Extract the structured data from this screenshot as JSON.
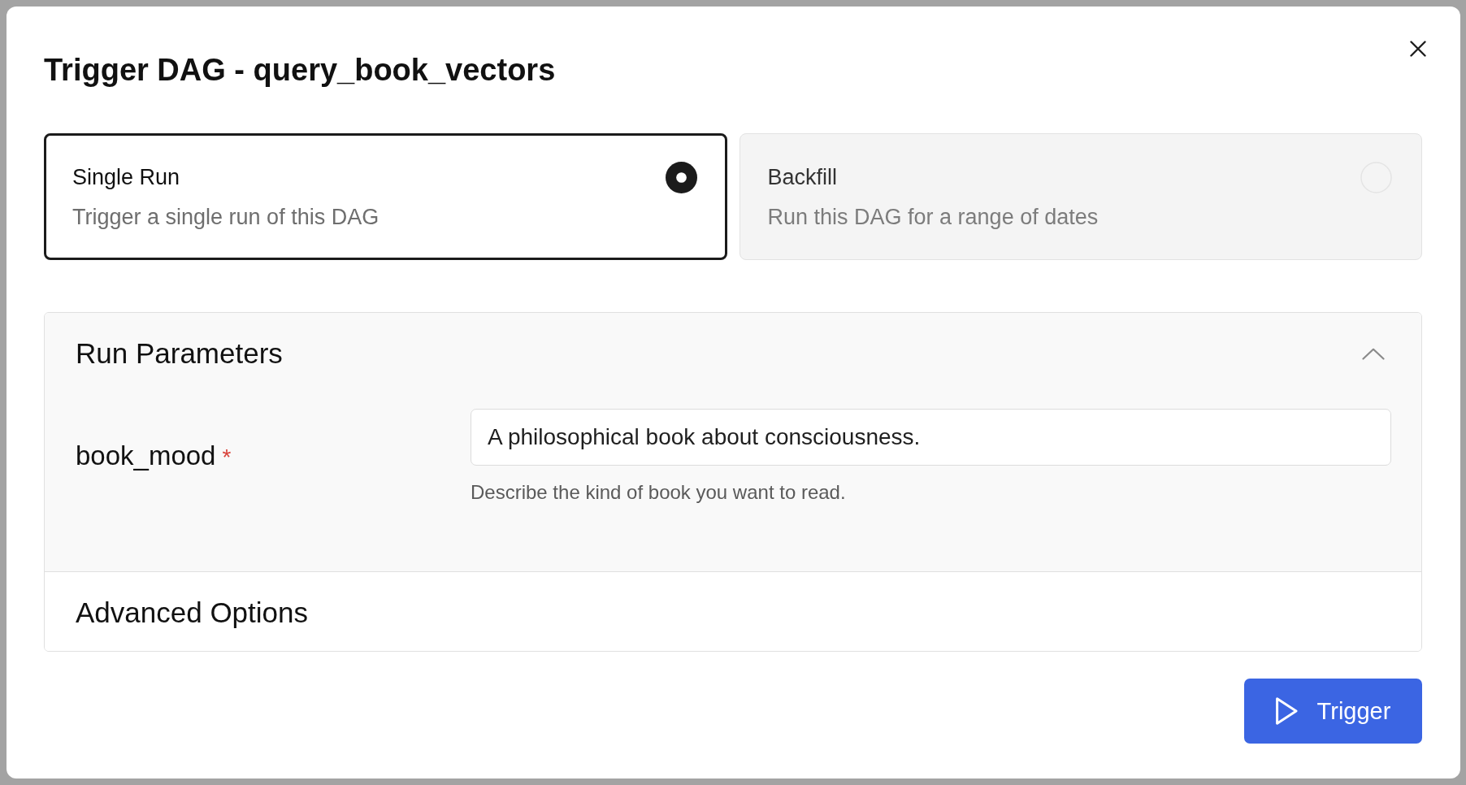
{
  "dialog": {
    "title": "Trigger DAG - query_book_vectors"
  },
  "run_modes": [
    {
      "title": "Single Run",
      "description": "Trigger a single run of this DAG",
      "selected": true
    },
    {
      "title": "Backfill",
      "description": "Run this DAG for a range of dates",
      "selected": false
    }
  ],
  "sections": [
    {
      "title": "Run Parameters",
      "expanded": true,
      "fields": [
        {
          "label": "book_mood",
          "required_marker": "*",
          "value": "A philosophical book about consciousness.",
          "help": "Describe the kind of book you want to read."
        }
      ]
    },
    {
      "title": "Advanced Options"
    }
  ],
  "buttons": [
    {
      "label": "Trigger",
      "kind": "primary"
    }
  ]
}
